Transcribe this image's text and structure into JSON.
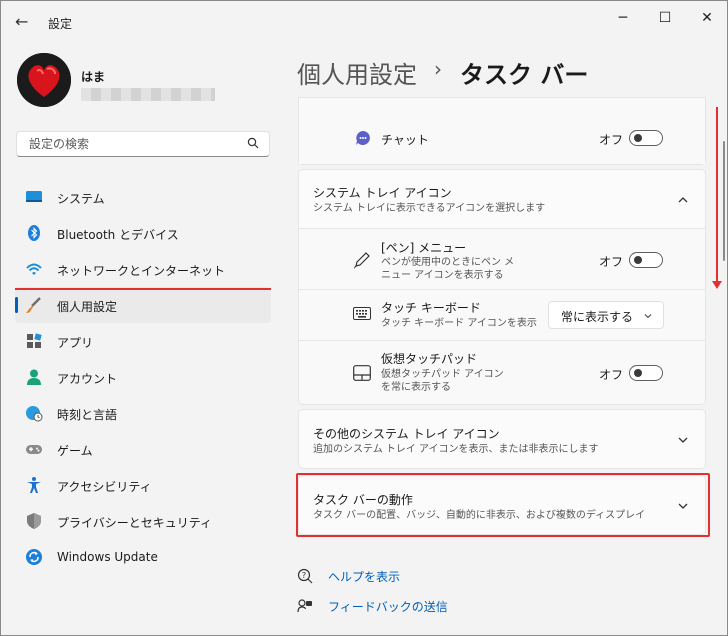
{
  "titlebar": {
    "title": "設定",
    "back_glyph": "←",
    "minimize_glyph": "─",
    "maximize_glyph": "☐",
    "close_glyph": "✕"
  },
  "profile": {
    "name": "はま"
  },
  "search": {
    "placeholder": "設定の検索"
  },
  "sidebar": {
    "items": [
      {
        "label": "システム",
        "icon": "system-icon"
      },
      {
        "label": "Bluetooth とデバイス",
        "icon": "bluetooth-icon"
      },
      {
        "label": "ネットワークとインターネット",
        "icon": "wifi-icon"
      },
      {
        "label": "個人用設定",
        "icon": "brush-icon",
        "active": true
      },
      {
        "label": "アプリ",
        "icon": "apps-icon"
      },
      {
        "label": "アカウント",
        "icon": "account-icon"
      },
      {
        "label": "時刻と言語",
        "icon": "globe-clock-icon"
      },
      {
        "label": "ゲーム",
        "icon": "gamepad-icon"
      },
      {
        "label": "アクセシビリティ",
        "icon": "accessibility-icon"
      },
      {
        "label": "プライバシーとセキュリティ",
        "icon": "shield-icon"
      },
      {
        "label": "Windows Update",
        "icon": "update-icon"
      }
    ]
  },
  "header": {
    "parent": "個人用設定",
    "separator": "›",
    "current": "タスク バー"
  },
  "chat": {
    "label": "チャット",
    "state": "オフ"
  },
  "tray": {
    "title": "システム トレイ アイコン",
    "subtitle": "システム トレイに表示できるアイコンを選択します",
    "items": [
      {
        "title": "[ペン] メニュー",
        "subtitle": "ペンが使用中のときにペン メニュー アイコンを表示する",
        "state": "オフ"
      },
      {
        "title": "タッチ キーボード",
        "subtitle": "タッチ キーボード アイコンを表示",
        "dropdown": "常に表示する"
      },
      {
        "title": "仮想タッチパッド",
        "subtitle": "仮想タッチパッド アイコンを常に表示する",
        "state": "オフ"
      }
    ]
  },
  "other_tray": {
    "title": "その他のシステム トレイ アイコン",
    "subtitle": "追加のシステム トレイ アイコンを表示、または非表示にします"
  },
  "behaviors": {
    "title": "タスク バーの動作",
    "subtitle": "タスク バーの配置、バッジ、自動的に非表示、および複数のディスプレイ"
  },
  "footer": {
    "help": "ヘルプを表示",
    "feedback": "フィードバックの送信"
  },
  "colors": {
    "accent": "#005fb8",
    "annotation": "#e03030"
  }
}
